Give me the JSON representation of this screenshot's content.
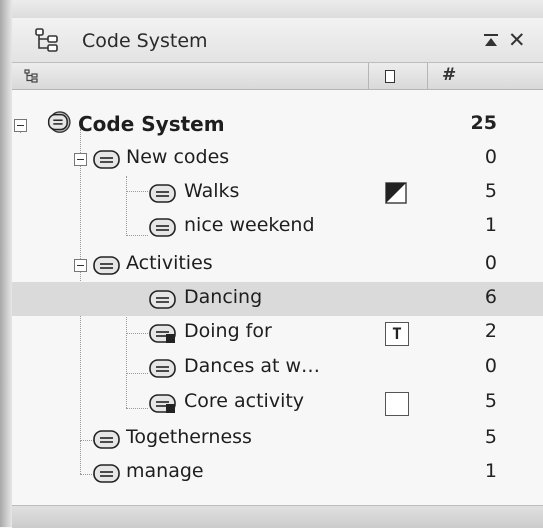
{
  "panel": {
    "title": "Code System",
    "title_icon": "code-system-tree-icon",
    "pin_icon": "pin-icon",
    "close_glyph": "✕"
  },
  "columns": {
    "name_icon": "tree-icon",
    "color_icon": "color-square-icon",
    "count_label": "#"
  },
  "tree": {
    "root": {
      "label": "Code System",
      "count": "25"
    },
    "items": [
      {
        "label": "New codes",
        "count": "0"
      },
      {
        "label": "Walks",
        "count": "5",
        "color_marker": "half-filled"
      },
      {
        "label": "nice weekend",
        "count": "1"
      },
      {
        "label": "Activities",
        "count": "0"
      },
      {
        "label": "Dancing",
        "count": "6",
        "selected": true
      },
      {
        "label": "Doing for",
        "count": "2",
        "color_marker": "T"
      },
      {
        "label": "Dances at w…",
        "count": "0"
      },
      {
        "label": "Core activity",
        "count": "5",
        "color_marker": "empty"
      },
      {
        "label": "Togetherness",
        "count": "5"
      },
      {
        "label": "manage",
        "count": "1"
      }
    ],
    "marker_T": "T"
  },
  "colors": {
    "selection": "#dadada",
    "header": "#e3e3e3"
  }
}
